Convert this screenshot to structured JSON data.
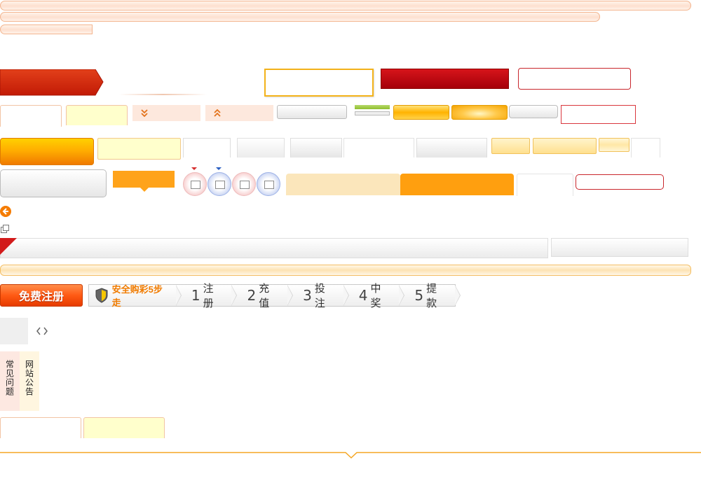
{
  "register": {
    "label": "免费注册"
  },
  "safety": {
    "label": "安全购彩5步走"
  },
  "steps": [
    {
      "num": "1",
      "label": "注册"
    },
    {
      "num": "2",
      "label": "充值"
    },
    {
      "num": "3",
      "label": "投注"
    },
    {
      "num": "4",
      "label": "中奖"
    },
    {
      "num": "5",
      "label": "提款"
    }
  ],
  "sidebar_tabs": [
    {
      "label": "常见问题"
    },
    {
      "label": "网站公告"
    }
  ],
  "icons": {
    "expand": "chevron-double-down",
    "collapse": "chevron-double-up",
    "back": "arrow-left-circle",
    "popout": "external-window",
    "code": "angle-brackets"
  },
  "colors": {
    "accent": "#ff9900",
    "brand_red": "#cc0000",
    "light_yellow": "#ffffcc",
    "peach": "#fde8dd"
  }
}
